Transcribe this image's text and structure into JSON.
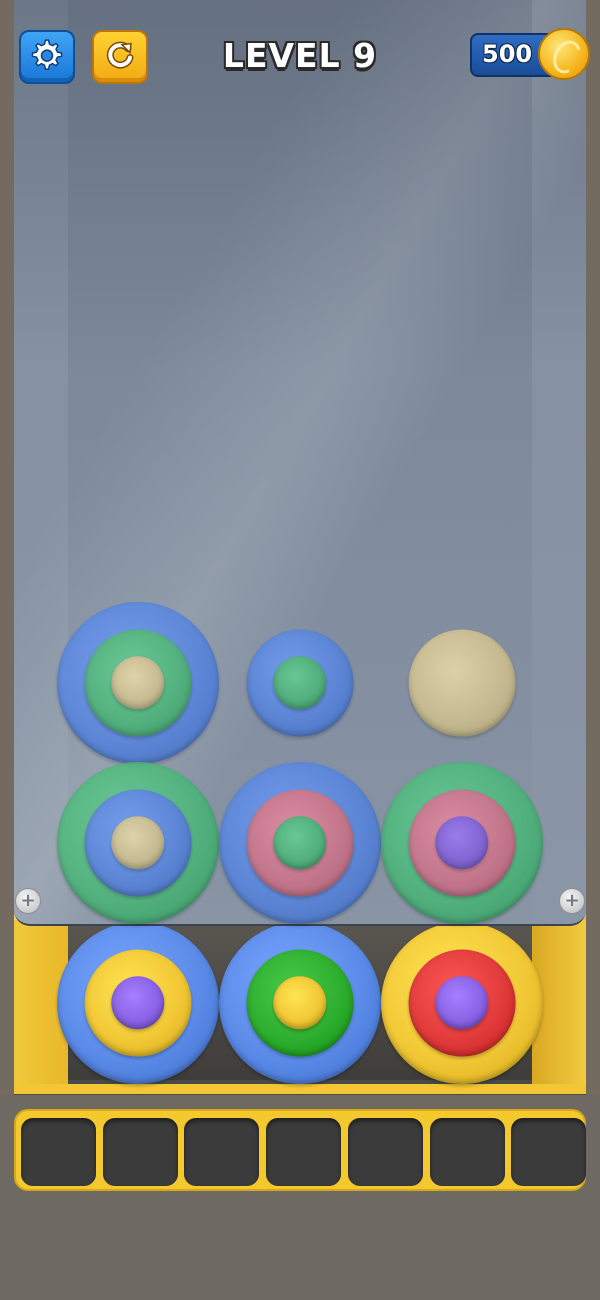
{
  "hud": {
    "level_label": "LEVEL 9",
    "coins": "500",
    "settings_icon": "gear-icon",
    "restart_icon": "restart-arrow-icon",
    "coin_icon": "gold-coin-icon"
  },
  "colors": {
    "blue": "#5b8be8",
    "green": "#4fbf7e",
    "dark_green": "#2eae2e",
    "tan": "#dccb96",
    "pink": "#d9798f",
    "purple": "#8a63e6",
    "yellow": "#f2c836",
    "red": "#e13b3b"
  },
  "board": {
    "behind_glass": [
      {
        "column": 1,
        "row": "top",
        "layers": [
          "blue",
          "green",
          "tan"
        ]
      },
      {
        "column": 2,
        "row": "top",
        "layers": [
          "blue",
          "green"
        ]
      },
      {
        "column": 3,
        "row": "top",
        "layers": [
          "tan"
        ]
      },
      {
        "column": 1,
        "row": "middle",
        "layers": [
          "green",
          "blue",
          "tan"
        ]
      },
      {
        "column": 2,
        "row": "middle",
        "layers": [
          "blue",
          "pink",
          "green"
        ]
      },
      {
        "column": 3,
        "row": "middle",
        "layers": [
          "green",
          "pink",
          "purple"
        ]
      }
    ],
    "front_row": [
      {
        "column": 1,
        "layers": [
          "blue",
          "yellow",
          "purple"
        ]
      },
      {
        "column": 2,
        "layers": [
          "blue",
          "dark_green",
          "yellow"
        ]
      },
      {
        "column": 3,
        "layers": [
          "yellow",
          "red",
          "purple"
        ]
      }
    ]
  },
  "tray": {
    "slot_count": 7,
    "slots": [
      "empty",
      "empty",
      "empty",
      "empty",
      "empty",
      "empty",
      "empty"
    ]
  }
}
